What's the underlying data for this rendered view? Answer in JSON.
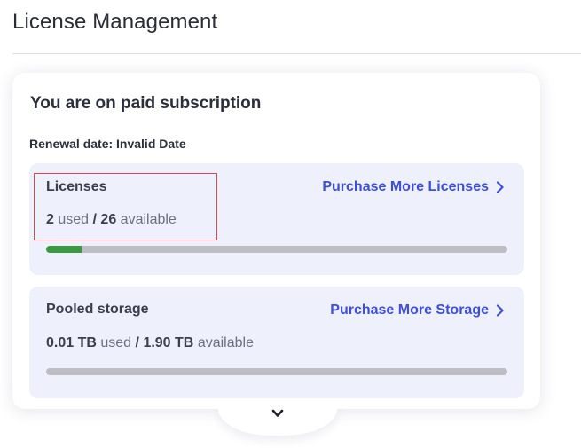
{
  "page": {
    "title": "License Management"
  },
  "subscription": {
    "title": "You are on paid subscription",
    "renewal": "Renewal date: Invalid Date"
  },
  "licenses": {
    "heading": "Licenses",
    "used": "2",
    "used_label": "used",
    "separator": "/",
    "available": "26",
    "available_label": "available",
    "link_label": "Purchase More Licenses",
    "usage_fraction": 0.0769
  },
  "storage": {
    "heading": "Pooled storage",
    "used": "0.01 TB",
    "used_label": "used",
    "separator": "/",
    "available": "1.90 TB",
    "available_label": "available",
    "link_label": "Purchase More Storage",
    "usage_fraction": 0.005
  },
  "colors": {
    "accent": "#3d4fd6",
    "progress_fill": "#3a9a3f",
    "progress_track": "#bdbec3",
    "panel_bg": "#eef0fb",
    "highlight": "#d9464c"
  },
  "icons": {
    "link_chevron": "chevron-right-icon",
    "expand": "chevron-down-icon"
  }
}
